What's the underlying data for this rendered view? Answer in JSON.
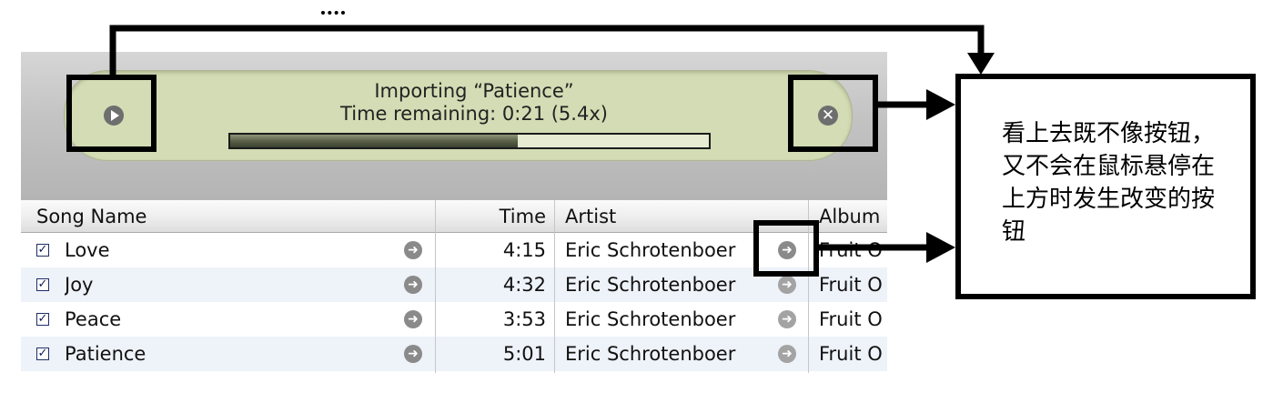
{
  "status": {
    "line1": "Importing “Patience”",
    "line2": "Time remaining: 0:21 (5.4x)",
    "progress": 0.6,
    "play_icon": "play-circle-icon",
    "stop_icon": "stop-circle-icon",
    "stop_glyph": "✕"
  },
  "table": {
    "headers": {
      "song": "Song Name",
      "time": "Time",
      "artist": "Artist",
      "album": "Album"
    },
    "rows": [
      {
        "checked": "✓",
        "song": "Love",
        "time": "4:15",
        "artist": "Eric Schrotenboer",
        "album": "Fruit O"
      },
      {
        "checked": "✓",
        "song": "Joy",
        "time": "4:32",
        "artist": "Eric Schrotenboer",
        "album": "Fruit O"
      },
      {
        "checked": "✓",
        "song": "Peace",
        "time": "3:53",
        "artist": "Eric Schrotenboer",
        "album": "Fruit O"
      },
      {
        "checked": "✓",
        "song": "Patience",
        "time": "5:01",
        "artist": "Eric Schrotenboer",
        "album": "Fruit O"
      }
    ],
    "arrow_glyph": "➜"
  },
  "annotation": {
    "text": "看上去既不像按钮，又不会在鼠标悬停在上方时发生改变的按钮"
  },
  "colors": {
    "lcd_background": "#d3dcb4",
    "row_alt": "#eef2f9",
    "annotation": "#000000"
  }
}
